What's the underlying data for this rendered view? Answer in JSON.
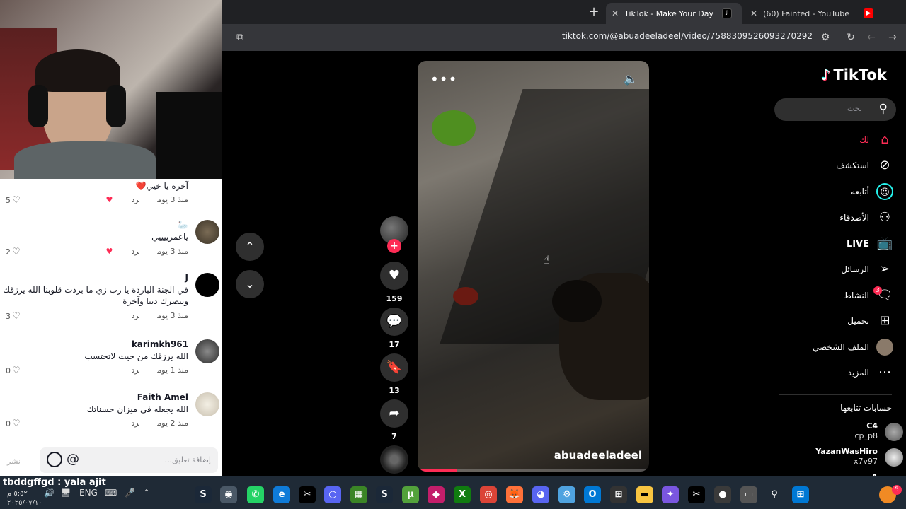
{
  "browser": {
    "tabs": [
      {
        "title": "TikTok - Make Your Day",
        "active": true
      },
      {
        "title": "(60) Fainted - YouTube",
        "active": false
      }
    ],
    "new_tab": "+",
    "close": "✕",
    "url": "tiktok.com/@abuadeeladeel/video/7588309526093270292"
  },
  "comments": [
    {
      "name": "",
      "text": "آخره يا خيي❤️",
      "time": "منذ 3 يوم",
      "reply": "رد",
      "likes": "5"
    },
    {
      "name": "🦢",
      "text": "ياعمرييييي",
      "time": "منذ 3 يوم",
      "reply": "رد",
      "likes": "2"
    },
    {
      "name": "J",
      "text": "في الجنة الباردة يا رب زي ما بردت قلوبنا الله يرزقك وينصرك دنيا وآخرة",
      "time": "منذ 3 يوم",
      "reply": "رد",
      "likes": "3"
    },
    {
      "name": "karimkh961",
      "text": "الله يرزقك من حيث لاتحتسب",
      "time": "منذ 1 يوم",
      "reply": "رد",
      "likes": "0"
    },
    {
      "name": "Faith Amel",
      "text": "الله يجعله في ميزان حسناتك",
      "time": "منذ 2 يوم",
      "reply": "رد",
      "likes": "0"
    }
  ],
  "comment_input": {
    "placeholder": "إضافة تعليق...",
    "at": "@",
    "post": "نشر"
  },
  "video": {
    "author": "abuadeeladeel",
    "menu": "•••",
    "progress": 0.17
  },
  "actions": {
    "likes": "159",
    "comments": "17",
    "saves": "13",
    "shares": "7"
  },
  "sidebar": {
    "logo": "TikTok",
    "search_placeholder": "بحث",
    "nav": [
      {
        "label": "لك"
      },
      {
        "label": "استكشف"
      },
      {
        "label": "أتابعه"
      },
      {
        "label": "الأصدقاء"
      },
      {
        "label": "LIVE"
      },
      {
        "label": "الرسائل"
      },
      {
        "label": "النشاط"
      },
      {
        "label": "تحميل"
      },
      {
        "label": "الملف الشخصي"
      },
      {
        "label": "المزيد"
      }
    ],
    "activity_badge": "3",
    "following_title": "حسابات تتابعها",
    "following": [
      {
        "name": "C4",
        "handle": "cp_p8"
      },
      {
        "name": "YazanWasHiro",
        "handle": "x7v97"
      },
      {
        "name": "A",
        "handle": ""
      }
    ]
  },
  "overlay_chat": "tbddgffgd : yala ajit",
  "taskbar": {
    "time": "٥:٥٢ م",
    "date": "٢٠٢٥/٠٧/١٠",
    "lang": "ENG",
    "notif": "5"
  },
  "colors": {
    "accent": "#fe2c55",
    "bg": "#000000",
    "panel": "#ffffff"
  }
}
